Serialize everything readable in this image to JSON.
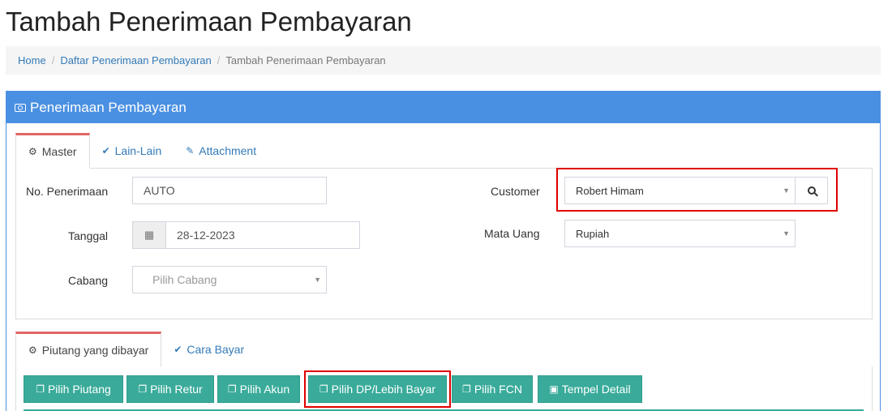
{
  "page": {
    "title": "Tambah Penerimaan Pembayaran"
  },
  "breadcrumb": {
    "home": "Home",
    "list": "Daftar Penerimaan Pembayaran",
    "current": "Tambah Penerimaan Pembayaran",
    "separator": "/"
  },
  "panel": {
    "title": "Penerimaan Pembayaran",
    "icon": "money-icon"
  },
  "tabs": [
    {
      "label": "Master",
      "icon": "gears-icon",
      "active": true
    },
    {
      "label": "Lain-Lain",
      "icon": "check-circle-icon",
      "active": false
    },
    {
      "label": "Attachment",
      "icon": "paperclip-icon",
      "active": false
    }
  ],
  "form": {
    "no_penerimaan": {
      "label": "No. Penerimaan",
      "value": "AUTO"
    },
    "tanggal": {
      "label": "Tanggal",
      "value": "28-12-2023",
      "icon": "calendar-icon"
    },
    "cabang": {
      "label": "Cabang",
      "placeholder": "Pilih Cabang"
    },
    "customer": {
      "label": "Customer",
      "value": "Robert Himam",
      "search_icon": "search-icon"
    },
    "mata_uang": {
      "label": "Mata Uang",
      "value": "Rupiah"
    }
  },
  "tabs2": [
    {
      "label": "Piutang yang dibayar",
      "icon": "gears-icon",
      "active": true
    },
    {
      "label": "Cara Bayar",
      "icon": "check-circle-icon",
      "active": false
    }
  ],
  "buttons": [
    {
      "label": "Pilih Piutang",
      "icon": "copy-icon"
    },
    {
      "label": "Pilih Retur",
      "icon": "copy-icon"
    },
    {
      "label": "Pilih Akun",
      "icon": "copy-icon"
    },
    {
      "label": "Pilih DP/Lebih Bayar",
      "icon": "copy-icon"
    },
    {
      "label": "Pilih FCN",
      "icon": "copy-icon"
    },
    {
      "label": "Tempel Detail",
      "icon": "paste-icon"
    }
  ],
  "colors": {
    "primary": "#4a90e2",
    "teal": "#3aab9a",
    "highlight": "#e00000",
    "active_tab_border": "#e06666"
  }
}
